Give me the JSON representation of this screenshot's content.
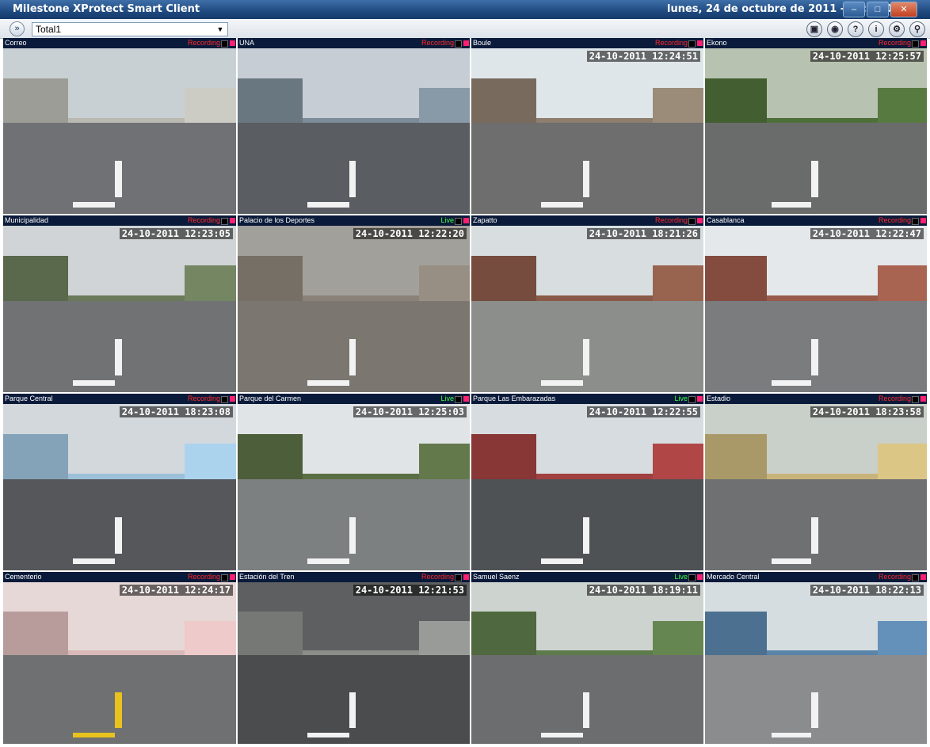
{
  "window": {
    "title": "Milestone XProtect Smart Client",
    "datetime": "lunes, 24 de octubre de 2011 - 12:25:01"
  },
  "toolbar": {
    "view_selected": "Total1",
    "icons": [
      "expand-icon",
      "fullscreen-icon",
      "status-icon",
      "help-icon",
      "info-icon",
      "settings-icon",
      "search-icon"
    ]
  },
  "cameras": [
    {
      "name": "Correo",
      "status": "Recording",
      "timestamp": "",
      "palette": [
        "#c8d0d4",
        "#b9b9b2",
        "#6f7174"
      ]
    },
    {
      "name": "UNA",
      "status": "Recording",
      "timestamp": "",
      "palette": [
        "#c7cdd4",
        "#7c8c98",
        "#5a5d61"
      ]
    },
    {
      "name": "Boule",
      "status": "Recording",
      "timestamp": "24-10-2011 12:24:51",
      "palette": [
        "#dfe6ea",
        "#8d7e6e",
        "#6d6e6d"
      ]
    },
    {
      "name": "Ekono",
      "status": "Recording",
      "timestamp": "24-10-2011 12:25:57",
      "palette": [
        "#b8c2b0",
        "#4f6f3a",
        "#6a6c6c"
      ]
    },
    {
      "name": "Municipalidad",
      "status": "Recording",
      "timestamp": "24-10-2011 12:23:05",
      "palette": [
        "#d0d4d6",
        "#6a7a5a",
        "#707274"
      ]
    },
    {
      "name": "Palacio de los Deportes",
      "status": "Live",
      "timestamp": "24-10-2011 12:22:20",
      "palette": [
        "#a2a09a",
        "#8a8278",
        "#7b7670"
      ]
    },
    {
      "name": "Zapatto",
      "status": "Recording",
      "timestamp": "24-10-2011 18:21:26",
      "palette": [
        "#d8dde0",
        "#8a5a48",
        "#8c8e8c"
      ]
    },
    {
      "name": "Casablanca",
      "status": "Recording",
      "timestamp": "24-10-2011 12:22:47",
      "palette": [
        "#e4e8ea",
        "#9a5a4a",
        "#7a7c7e"
      ]
    },
    {
      "name": "Parque Central",
      "status": "Recording",
      "timestamp": "24-10-2011 18:23:08",
      "palette": [
        "#d2d8dc",
        "#9cc0d8",
        "#55575a"
      ]
    },
    {
      "name": "Parque del Carmen",
      "status": "Live",
      "timestamp": "24-10-2011 12:25:03",
      "palette": [
        "#e0e4e6",
        "#5a6e44",
        "#7d8080"
      ]
    },
    {
      "name": "Parque Las Embarazadas",
      "status": "Live",
      "timestamp": "24-10-2011 12:22:55",
      "palette": [
        "#d6dcdf",
        "#a04040",
        "#4f5254"
      ]
    },
    {
      "name": "Estadio",
      "status": "Recording",
      "timestamp": "24-10-2011 18:23:58",
      "palette": [
        "#c9cfc9",
        "#c8b47a",
        "#6e7071"
      ]
    },
    {
      "name": "Cementerio",
      "status": "Recording",
      "timestamp": "24-10-2011 12:24:17",
      "palette": [
        "#e6d8d6",
        "#d9b8b8",
        "#6f7072"
      ]
    },
    {
      "name": "Estación del Tren",
      "status": "Recording",
      "timestamp": "24-10-2011 12:21:53",
      "palette": [
        "#5d5f61",
        "#8b8d8a",
        "#4a4c4e"
      ]
    },
    {
      "name": "Samuel Saenz",
      "status": "Live",
      "timestamp": "24-10-2011 18:19:11",
      "palette": [
        "#cdd3cf",
        "#5d7a4a",
        "#6b6d6e"
      ]
    },
    {
      "name": "Mercado Central",
      "status": "Recording",
      "timestamp": "24-10-2011 18:22:13",
      "palette": [
        "#d6dde0",
        "#5a84a8",
        "#8a8c8d"
      ]
    }
  ]
}
